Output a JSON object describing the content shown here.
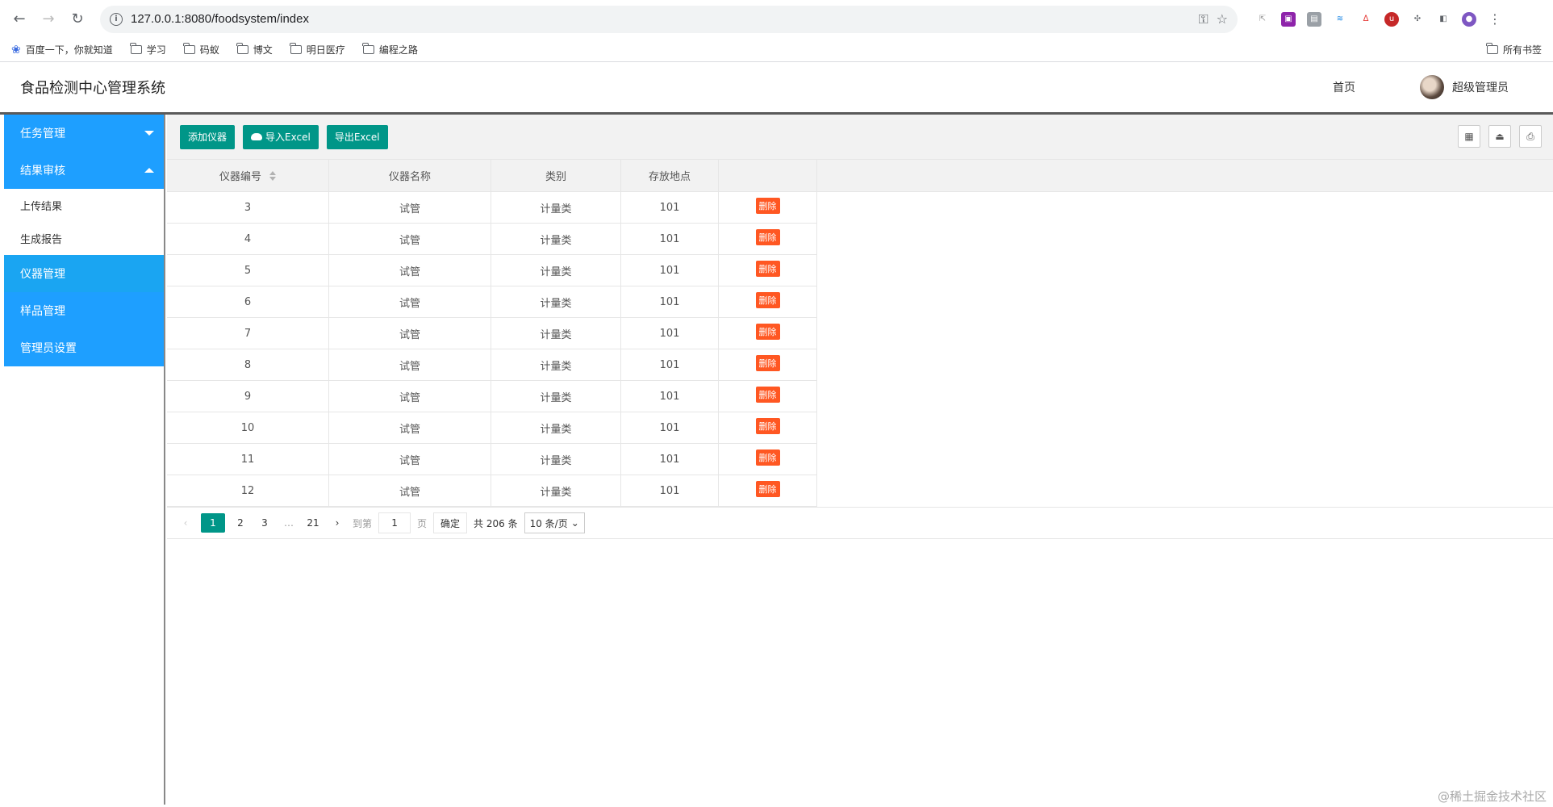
{
  "browser": {
    "url": "127.0.0.1:8080/foodsystem/index",
    "bookmarks": [
      "百度一下，你就知道",
      "学习",
      "码蚁",
      "博文",
      "明日医疗",
      "编程之路"
    ],
    "all_bookmarks": "所有书签"
  },
  "header": {
    "title": "食品检测中心管理系统",
    "home": "首页",
    "user": "超级管理员"
  },
  "sidebar": {
    "task": "任务管理",
    "review": "结果审核",
    "upload": "上传结果",
    "report": "生成报告",
    "instrument": "仪器管理",
    "sample": "样品管理",
    "admin": "管理员设置"
  },
  "toolbar": {
    "add": "添加仪器",
    "import": "导入Excel",
    "export": "导出Excel"
  },
  "table": {
    "headers": [
      "仪器编号",
      "仪器名称",
      "类别",
      "存放地点"
    ],
    "delete_label": "删除",
    "rows": [
      {
        "id": "3",
        "name": "试管",
        "category": "计量类",
        "location": "101"
      },
      {
        "id": "4",
        "name": "试管",
        "category": "计量类",
        "location": "101"
      },
      {
        "id": "5",
        "name": "试管",
        "category": "计量类",
        "location": "101"
      },
      {
        "id": "6",
        "name": "试管",
        "category": "计量类",
        "location": "101"
      },
      {
        "id": "7",
        "name": "试管",
        "category": "计量类",
        "location": "101"
      },
      {
        "id": "8",
        "name": "试管",
        "category": "计量类",
        "location": "101"
      },
      {
        "id": "9",
        "name": "试管",
        "category": "计量类",
        "location": "101"
      },
      {
        "id": "10",
        "name": "试管",
        "category": "计量类",
        "location": "101"
      },
      {
        "id": "11",
        "name": "试管",
        "category": "计量类",
        "location": "101"
      },
      {
        "id": "12",
        "name": "试管",
        "category": "计量类",
        "location": "101"
      }
    ]
  },
  "pager": {
    "pages": [
      "1",
      "2",
      "3"
    ],
    "ellipsis": "…",
    "last": "21",
    "goto": "到第",
    "input": "1",
    "page_unit": "页",
    "confirm": "确定",
    "total": "共 206 条",
    "per_page": "10 条/页"
  },
  "watermark": "@稀土掘金技术社区"
}
